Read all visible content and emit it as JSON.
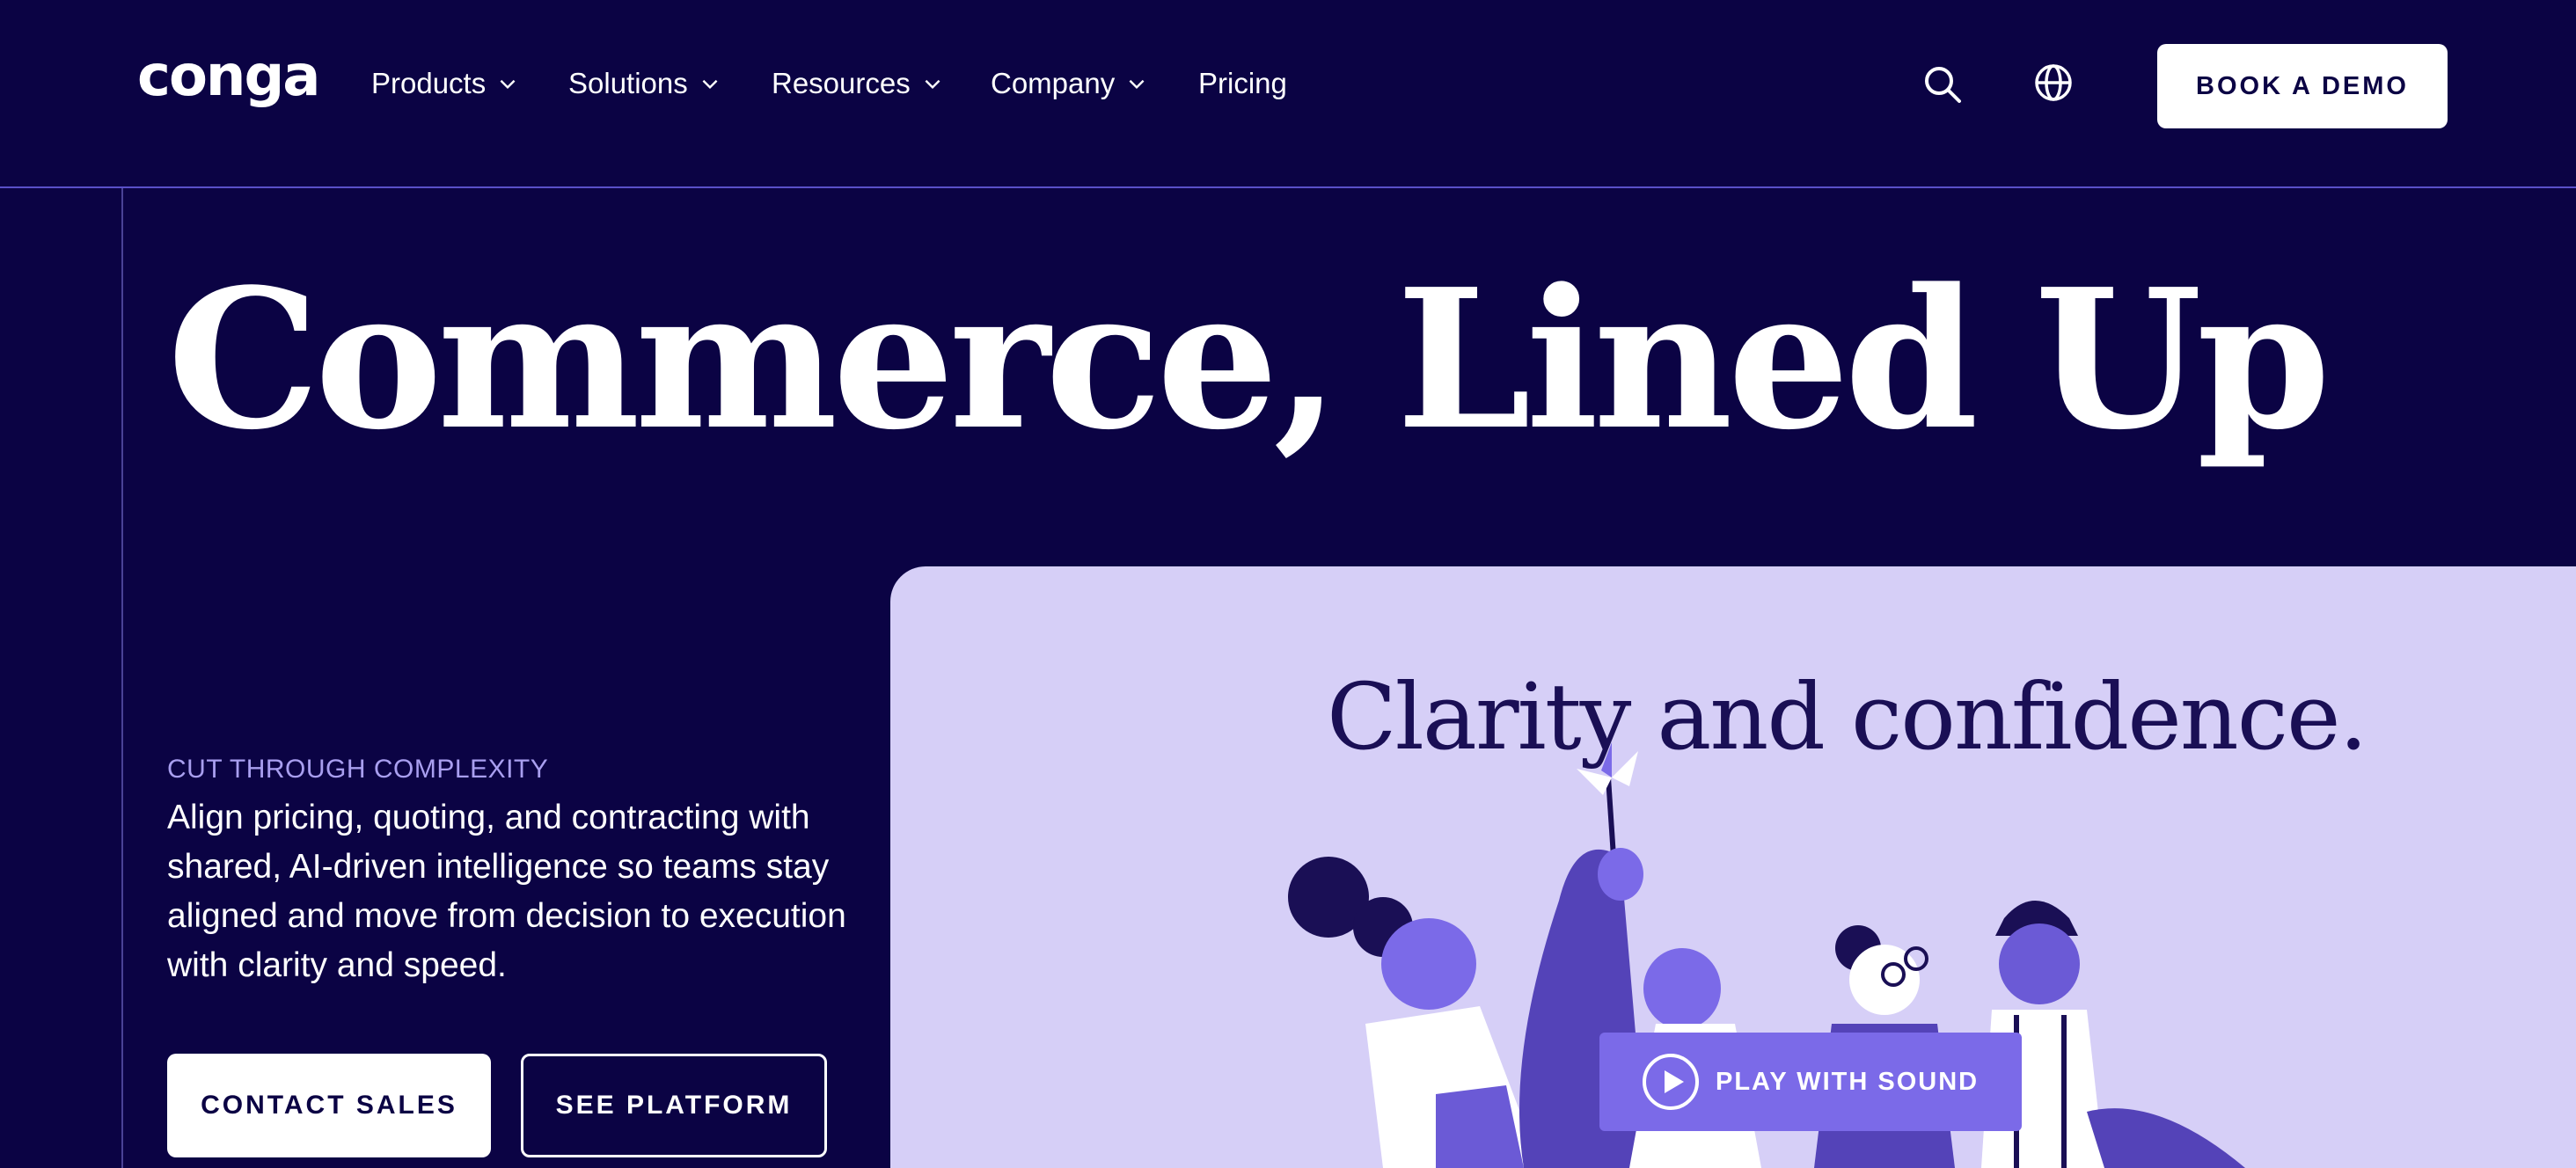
{
  "brand": {
    "logo_text": "conga"
  },
  "nav": {
    "items": [
      {
        "label": "Products",
        "has_dropdown": true
      },
      {
        "label": "Solutions",
        "has_dropdown": true
      },
      {
        "label": "Resources",
        "has_dropdown": true
      },
      {
        "label": "Company",
        "has_dropdown": true
      },
      {
        "label": "Pricing",
        "has_dropdown": false
      }
    ],
    "icons": [
      "search-icon",
      "globe-icon"
    ],
    "cta_label": "BOOK A DEMO"
  },
  "hero": {
    "title": "Commerce, Lined Up",
    "eyebrow": "CUT THROUGH COMPLEXITY",
    "description": "Align pricing, quoting, and contracting with shared, AI-driven intelligence so teams stay aligned and move from decision to execution with clarity and speed.",
    "primary_cta": "CONTACT SALES",
    "secondary_cta": "SEE PLATFORM"
  },
  "media": {
    "headline": "Clarity and confidence.",
    "play_label": "PLAY WITH SOUND"
  },
  "colors": {
    "background": "#0b0344",
    "accent": "#7b6ae8",
    "eyebrow": "#a99ff0",
    "media_bg": "#d6cff7"
  }
}
